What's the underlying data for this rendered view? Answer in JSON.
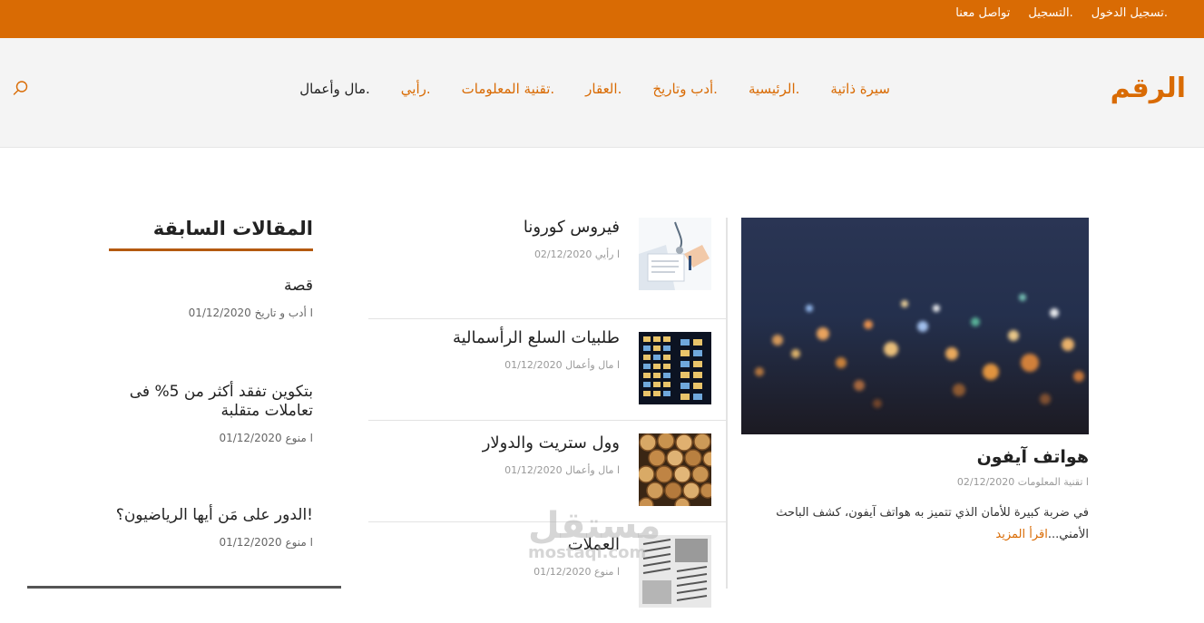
{
  "topbar": {
    "links": [
      "تسجيل الدخول.",
      "التسجيل.",
      "تواصل معنا"
    ]
  },
  "header": {
    "logo": "الرقم",
    "nav": [
      "سيرة ذاتية",
      "الرئيسية.",
      "أدب وتاريخ.",
      "العقار.",
      "تقنية المعلومات.",
      "رأيي.",
      "مال وأعمال."
    ]
  },
  "feature": {
    "title": "هواتف آيفون",
    "meta": "02/12/2020 ا تقنية المعلومات",
    "excerpt": "في ضربة كبيرة للأمان الذي تتميز به هواتف آيفون، كشف الباحث الأمني...",
    "more": "اقرأ المزيد"
  },
  "list": [
    {
      "title": "فيروس كورونا",
      "meta": "02/12/2020 ا رأيي"
    },
    {
      "title": "طلبيات السلع الرأسمالية",
      "meta": "01/12/2020 ا مال وأعمال"
    },
    {
      "title": "وول ستريت والدولار",
      "meta": "01/12/2020 ا مال وأعمال"
    },
    {
      "title": "العملات",
      "meta": "01/12/2020 ا منوع"
    }
  ],
  "sidebar": {
    "heading": "المقالات السابقة",
    "items": [
      {
        "title": "قصة",
        "meta": "01/12/2020 ا أدب و تاريخ"
      },
      {
        "title": "بتكوين تفقد أكثر من 5% فى تعاملات متقلبة",
        "meta": "01/12/2020 ا منوع"
      },
      {
        "title": "الدور على مَن أيها الرياضيون؟!",
        "meta": "01/12/2020 ا منوع"
      }
    ]
  },
  "watermark": {
    "line1": "مستقل",
    "line2": "mostaql.com"
  },
  "colors": {
    "accent": "#d96b04"
  }
}
